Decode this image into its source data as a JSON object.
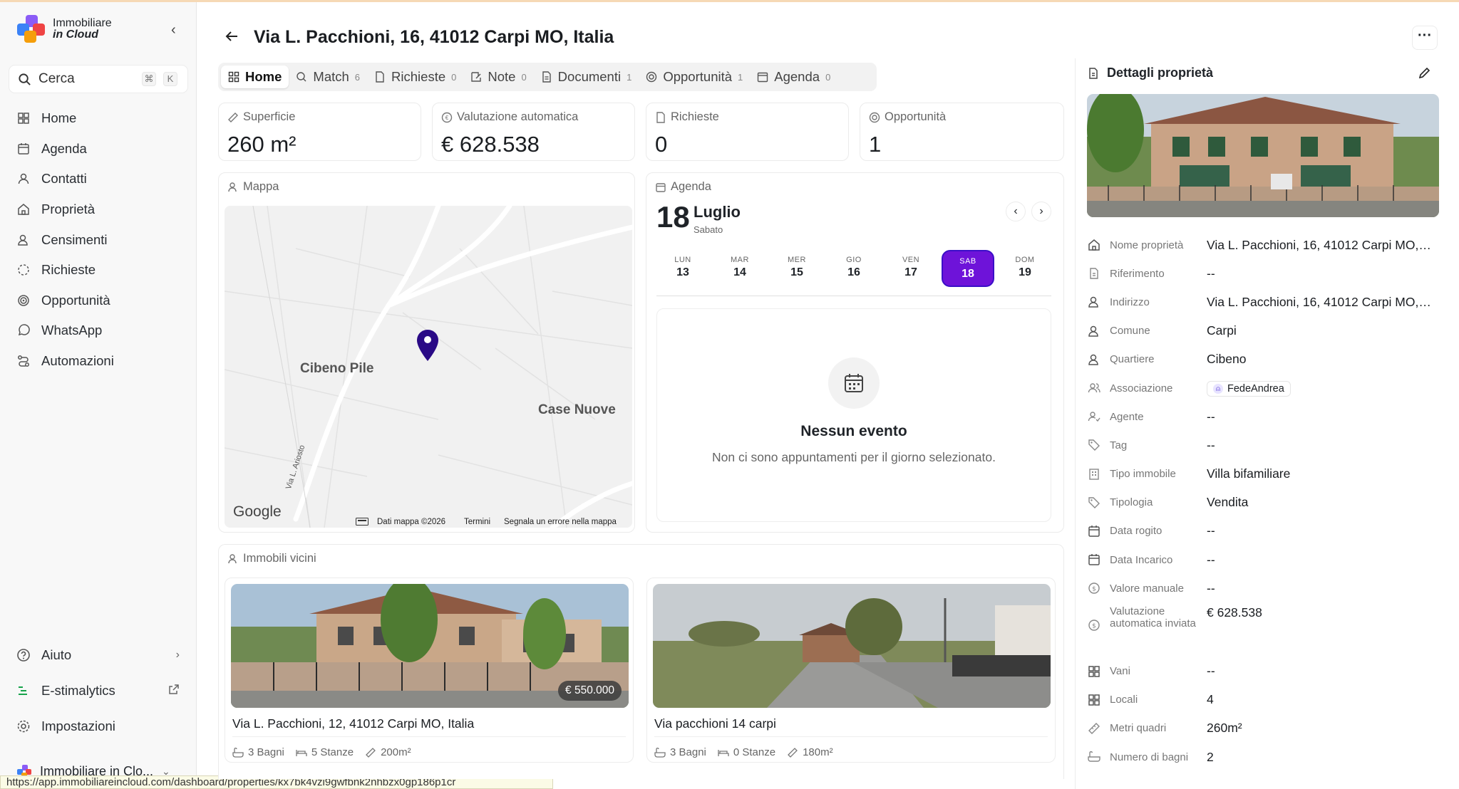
{
  "app": {
    "logo_line1": "Immobiliare",
    "logo_line2": "in Cloud",
    "search_label": "Cerca",
    "search_kbd1": "⌘",
    "search_kbd2": "K",
    "account_label": "Immobiliare in Clo...",
    "status_url": "https://app.immobiliareincloud.com/dashboard/properties/kx7bk4vzi9gwfbnk2nhbzx0gp186p1cr"
  },
  "sidebar": {
    "items": [
      {
        "label": "Home",
        "icon": "grid-icon"
      },
      {
        "label": "Agenda",
        "icon": "calendar-icon"
      },
      {
        "label": "Contatti",
        "icon": "user-icon"
      },
      {
        "label": "Proprietà",
        "icon": "house-icon"
      },
      {
        "label": "Censimenti",
        "icon": "user-search-icon"
      },
      {
        "label": "Richieste",
        "icon": "dashed-circle-icon"
      },
      {
        "label": "Opportunità",
        "icon": "target-icon"
      },
      {
        "label": "WhatsApp",
        "icon": "whatsapp-icon"
      },
      {
        "label": "Automazioni",
        "icon": "route-icon"
      }
    ],
    "bottom": [
      {
        "label": "Aiuto",
        "icon": "help-icon"
      },
      {
        "label": "E-stimalytics",
        "icon": "list-icon"
      },
      {
        "label": "Impostazioni",
        "icon": "gear-icon"
      }
    ]
  },
  "header": {
    "title": "Via L. Pacchioni, 16, 41012 Carpi MO, Italia"
  },
  "tabs": [
    {
      "label": "Home",
      "count": ""
    },
    {
      "label": "Match",
      "count": "6"
    },
    {
      "label": "Richieste",
      "count": "0"
    },
    {
      "label": "Note",
      "count": "0"
    },
    {
      "label": "Documenti",
      "count": "1"
    },
    {
      "label": "Opportunità",
      "count": "1"
    },
    {
      "label": "Agenda",
      "count": "0"
    }
  ],
  "stats": [
    {
      "label": "Superficie",
      "value": "260 m²"
    },
    {
      "label": "Valutazione automatica",
      "value": "€ 628.538"
    },
    {
      "label": "Richieste",
      "value": "0"
    },
    {
      "label": "Opportunità",
      "value": "1"
    }
  ],
  "map": {
    "label": "Mappa",
    "place1": "Cibeno Pile",
    "place2": "Case Nuove",
    "street": "Via L. Ariosto",
    "google": "Google",
    "foot_data": "Dati mappa ©2026",
    "foot_terms": "Termini",
    "foot_report": "Segnala un errore nella mappa"
  },
  "agenda": {
    "label": "Agenda",
    "day": "18",
    "month": "Luglio",
    "weekday": "Sabato",
    "week": [
      {
        "n": "LUN",
        "d": "13"
      },
      {
        "n": "MAR",
        "d": "14"
      },
      {
        "n": "MER",
        "d": "15"
      },
      {
        "n": "GIO",
        "d": "16"
      },
      {
        "n": "VEN",
        "d": "17"
      },
      {
        "n": "SAB",
        "d": "18"
      },
      {
        "n": "DOM",
        "d": "19"
      }
    ],
    "empty_title": "Nessun evento",
    "empty_sub": "Non ci sono appuntamenti per il giorno selezionato."
  },
  "nearby": {
    "label": "Immobili vicini",
    "items": [
      {
        "title": "Via L. Pacchioni, 12, 41012 Carpi MO, Italia",
        "price": "€ 550.000",
        "bagni": "3 Bagni",
        "stanze": "5 Stanze",
        "mq": "200m²"
      },
      {
        "title": "Via pacchioni 14 carpi",
        "price": "",
        "bagni": "3 Bagni",
        "stanze": "0 Stanze",
        "mq": "180m²"
      }
    ]
  },
  "details": {
    "title": "Dettagli proprietà",
    "rows": [
      {
        "label": "Nome proprietà",
        "value": "Via L. Pacchioni, 16, 41012 Carpi MO, It...",
        "icon": "house-icon"
      },
      {
        "label": "Riferimento",
        "value": "--",
        "icon": "document-icon"
      },
      {
        "label": "Indirizzo",
        "value": "Via L. Pacchioni, 16, 41012 Carpi MO, It...",
        "icon": "user-search-icon"
      },
      {
        "label": "Comune",
        "value": "Carpi",
        "icon": "user-search-icon"
      },
      {
        "label": "Quartiere",
        "value": "Cibeno",
        "icon": "user-search-icon"
      },
      {
        "label": "Associazione",
        "value": "FedeAndrea",
        "icon": "users-icon"
      },
      {
        "label": "Agente",
        "value": "--",
        "icon": "user-check-icon"
      },
      {
        "label": "Tag",
        "value": "--",
        "icon": "tag-icon"
      },
      {
        "label": "Tipo immobile",
        "value": "Villa bifamiliare",
        "icon": "building-icon"
      },
      {
        "label": "Tipologia",
        "value": "Vendita",
        "icon": "tag-icon"
      },
      {
        "label": "Data rogito",
        "value": "--",
        "icon": "calendar-icon"
      },
      {
        "label": "Data Incarico",
        "value": "--",
        "icon": "calendar-icon"
      },
      {
        "label": "Valore manuale",
        "value": "--",
        "icon": "dollar-circle-icon"
      },
      {
        "label": "Valutazione automatica inviata",
        "value": "€ 628.538",
        "icon": "dollar-circle-icon"
      },
      {
        "label": "Vani",
        "value": "--",
        "icon": "grid-icon"
      },
      {
        "label": "Locali",
        "value": "4",
        "icon": "grid-icon"
      },
      {
        "label": "Metri quadri",
        "value": "260m²",
        "icon": "ruler-icon"
      },
      {
        "label": "Numero di bagni",
        "value": "2",
        "icon": "bath-icon"
      }
    ]
  },
  "colors": {
    "accent": "#6e13d9",
    "pin": "#2a0a86"
  }
}
